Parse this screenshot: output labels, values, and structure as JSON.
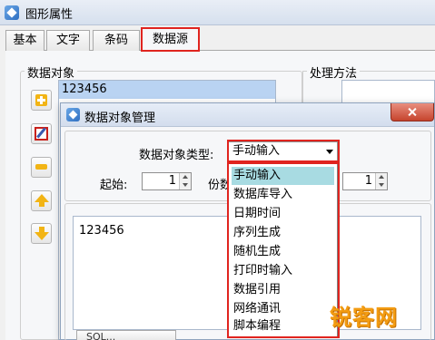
{
  "window": {
    "title": "图形属性"
  },
  "tabs": [
    {
      "label": "基本"
    },
    {
      "label": "文字"
    },
    {
      "label": "条码"
    },
    {
      "label": "数据源"
    }
  ],
  "data_objects": {
    "group_label": "数据对象",
    "items": [
      "123456"
    ]
  },
  "processing": {
    "group_label": "处理方法"
  },
  "dialog": {
    "title": "数据对象管理",
    "type_label": "数据对象类型:",
    "type_value": "手动输入",
    "start_label": "起始:",
    "start_value": "1",
    "copies_label": "份数",
    "copies_value": "1",
    "content": "123456",
    "bottom_button": "SQL..."
  },
  "dropdown": {
    "options": [
      "手动输入",
      "数据库导入",
      "日期时间",
      "序列生成",
      "随机生成",
      "打印时输入",
      "数据引用",
      "网络通讯",
      "脚本编程"
    ],
    "selected": "手动输入"
  },
  "watermark": {
    "text": "锐客网"
  },
  "colors": {
    "highlight_red": "#e0241f",
    "selection_blue": "#b9d3f2",
    "dropdown_selected": "#a8dbe2"
  }
}
